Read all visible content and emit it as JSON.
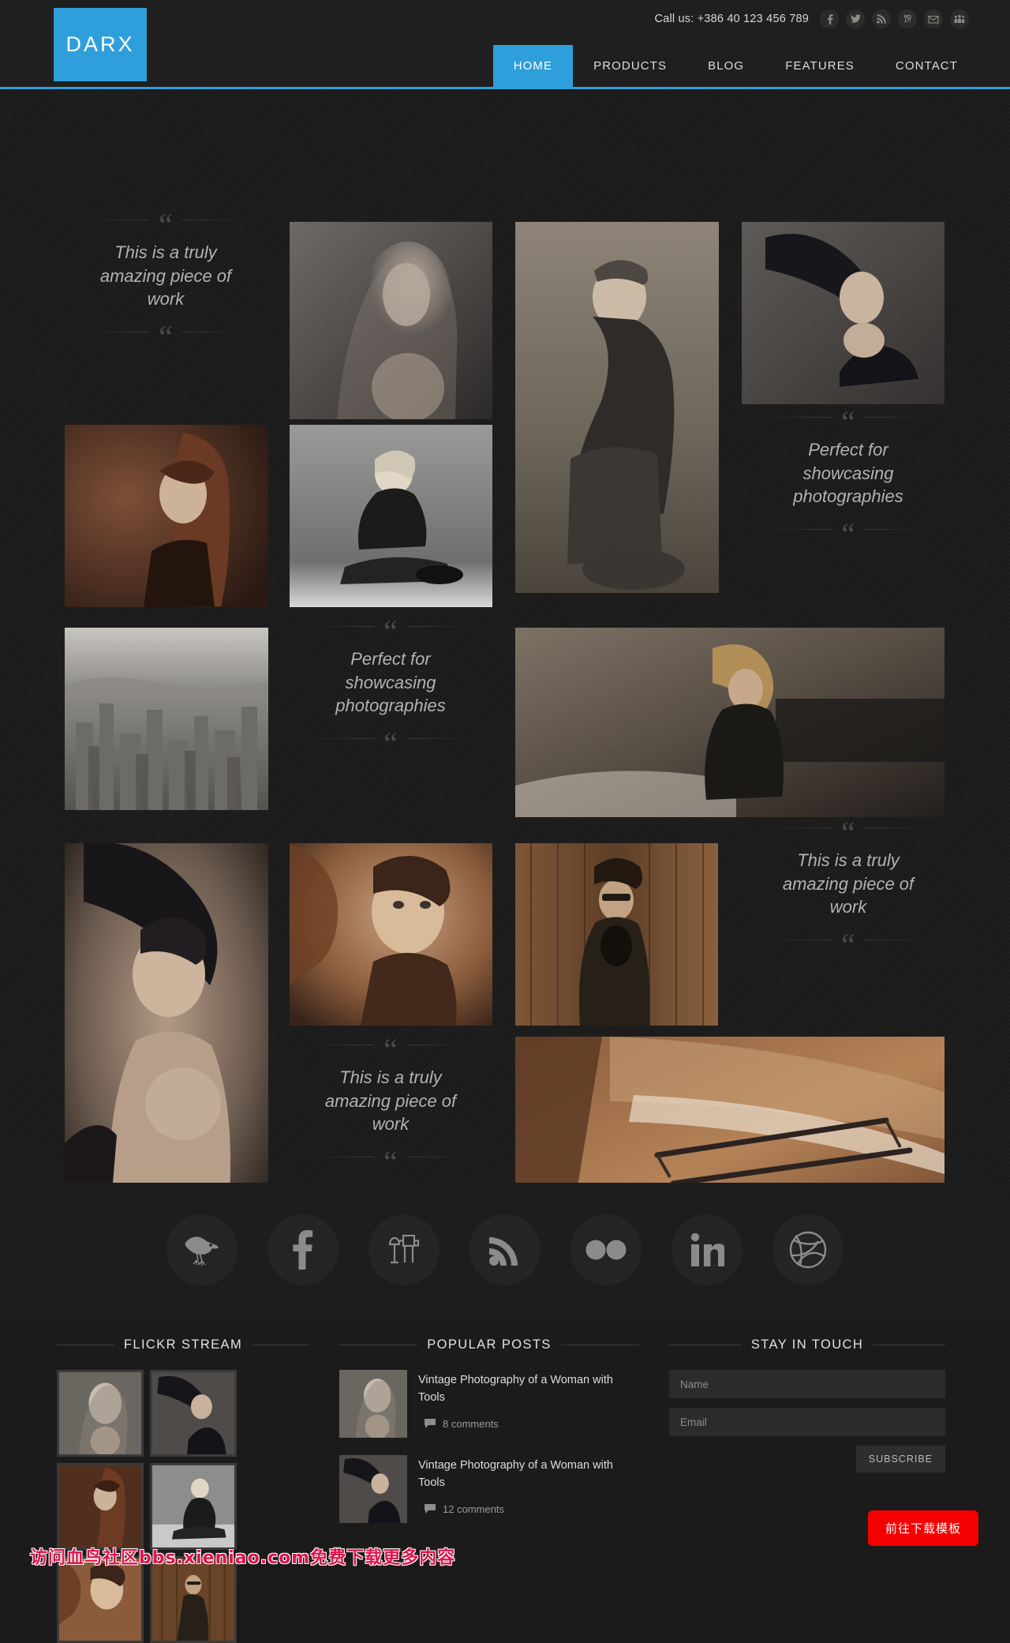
{
  "header": {
    "logo": "DARX",
    "call_us": "Call us: +386 40 123 456 789",
    "mini_social": [
      {
        "name": "facebook-icon",
        "label": "Facebook"
      },
      {
        "name": "twitter-icon",
        "label": "Twitter"
      },
      {
        "name": "rss-icon",
        "label": "RSS"
      },
      {
        "name": "pinterest-icon",
        "label": "Pinterest"
      },
      {
        "name": "email-icon",
        "label": "Email"
      },
      {
        "name": "myspace-icon",
        "label": "MySpace"
      }
    ],
    "nav": [
      {
        "label": "HOME",
        "active": true
      },
      {
        "label": "PRODUCTS",
        "active": false
      },
      {
        "label": "BLOG",
        "active": false
      },
      {
        "label": "FEATURES",
        "active": false
      },
      {
        "label": "CONTACT",
        "active": false
      }
    ]
  },
  "gallery": {
    "quotes": [
      {
        "text": "This is a truly amazing piece of work"
      },
      {
        "text": "Perfect for showcasing photographies"
      },
      {
        "text": "Perfect for showcasing photographies"
      },
      {
        "text": "This is a truly amazing piece of work"
      },
      {
        "text": "This is a truly amazing piece of work"
      }
    ],
    "items": [
      {
        "alt": "Blonde woman portrait in black and white"
      },
      {
        "alt": "Woman in hat sitting with arms on knees"
      },
      {
        "alt": "Woman with flowing dark hair"
      },
      {
        "alt": "Woman with long red hair in profile"
      },
      {
        "alt": "Blonde woman sitting on floor in black outfit"
      },
      {
        "alt": "Aerial black and white city skyline"
      },
      {
        "alt": "Blonde woman leaning on a car"
      },
      {
        "alt": "Woman looking upward with dark hair"
      },
      {
        "alt": "Woman in sepia tones with jewellery"
      },
      {
        "alt": "Woman with sunglasses against wooden wall"
      },
      {
        "alt": "Vintage car windshield with wipers in sepia"
      }
    ]
  },
  "social_row": [
    {
      "name": "twitter-bird-icon",
      "label": "Twitter"
    },
    {
      "name": "facebook-icon",
      "label": "Facebook"
    },
    {
      "name": "pinterest-icon",
      "label": "Pinterest"
    },
    {
      "name": "rss-icon",
      "label": "RSS"
    },
    {
      "name": "flickr-icon",
      "label": "Flickr"
    },
    {
      "name": "linkedin-icon",
      "label": "LinkedIn"
    },
    {
      "name": "dribbble-icon",
      "label": "Dribbble"
    }
  ],
  "footer": {
    "flickr": {
      "title": "FLICKR STREAM",
      "thumbs": [
        {
          "alt": "Blonde woman portrait"
        },
        {
          "alt": "Woman with flying dark hair"
        },
        {
          "alt": "Woman with red hair in profile"
        },
        {
          "alt": "Blonde woman sitting on floor"
        },
        {
          "alt": "Woman with jewellery in sepia"
        },
        {
          "alt": "Woman against wooden wall"
        }
      ]
    },
    "popular": {
      "title": "POPULAR POSTS",
      "posts": [
        {
          "title": "Vintage Photography of a Woman with Tools",
          "comments": "8 comments",
          "alt": "Blonde woman portrait"
        },
        {
          "title": "Vintage Photography of a Woman with Tools",
          "comments": "12 comments",
          "alt": "Woman with flying dark hair"
        }
      ]
    },
    "touch": {
      "title": "STAY IN TOUCH",
      "name_placeholder": "Name",
      "name_value": "",
      "email_placeholder": "Email",
      "email_value": "",
      "subscribe_label": "SUBSCRIBE"
    }
  },
  "overlay": {
    "watermark": "访问血鸟社区bbs.xieniao.com免费下载更多内容",
    "cta_label": "前往下载模板"
  },
  "colors": {
    "accent": "#2f9fdb",
    "cta": "#f50000",
    "watermark": "#e0144b",
    "page_bg": "#1d1d1d"
  }
}
